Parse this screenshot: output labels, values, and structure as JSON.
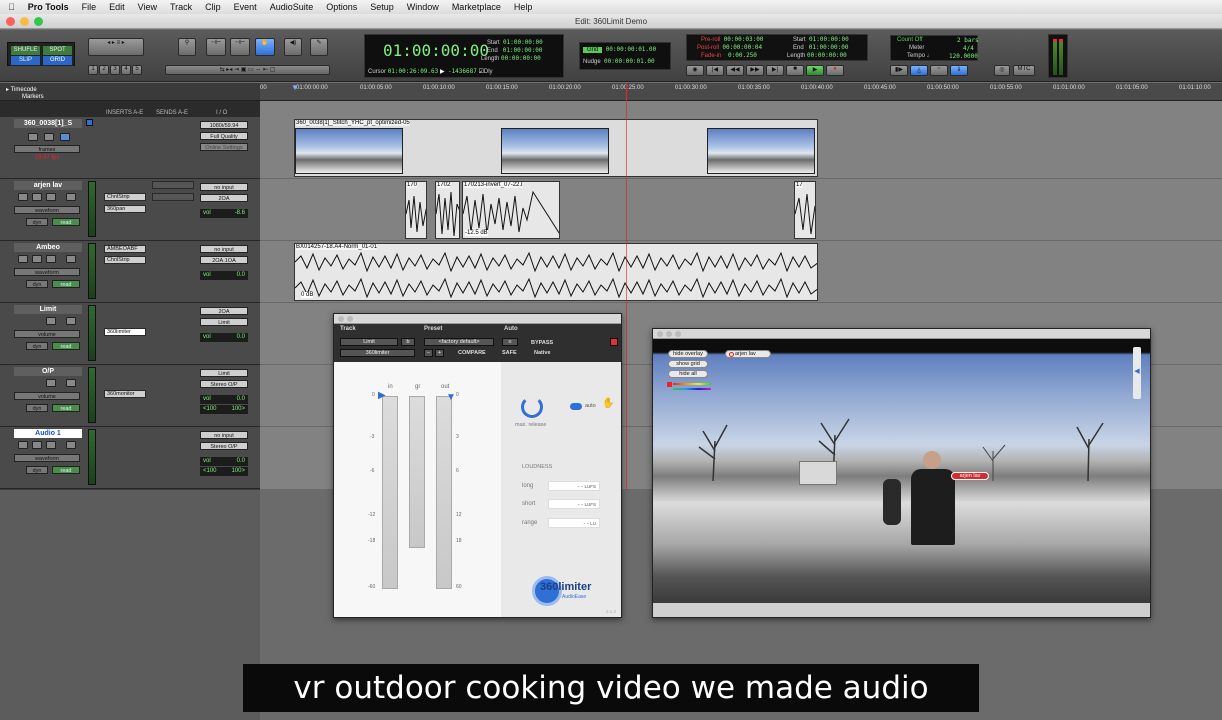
{
  "menubar": {
    "items": [
      "Pro Tools",
      "File",
      "Edit",
      "View",
      "Track",
      "Clip",
      "Event",
      "AudioSuite",
      "Options",
      "Setup",
      "Window",
      "Marketplace",
      "Help"
    ]
  },
  "window": {
    "title": "Edit: 360Limit Demo"
  },
  "toolbar": {
    "modes": [
      "SHUFLE",
      "SPOT",
      "SLIP",
      "GRID"
    ],
    "zoom_presets": [
      "1",
      "2",
      "3",
      "4",
      "5"
    ],
    "counter": {
      "main": "01:00:00:00",
      "start_label": "Start",
      "start": "01:00:00:00",
      "end_label": "End",
      "end": "01:00:00:00",
      "length_label": "Length",
      "length": "00:00:00:00",
      "cursor_label": "Cursor",
      "cursor": "01:00:26:09.63",
      "cursor_value": "-1436687",
      "dly_label": "Dly"
    },
    "grid": {
      "grid_label": "Grid",
      "grid_value": "00:00:00:01.00",
      "nudge_label": "Nudge",
      "nudge_value": "00:00:00:01.00"
    },
    "transport": {
      "preroll_label": "Pre-roll",
      "preroll": "00:00:03:00",
      "postroll_label": "Post-roll",
      "postroll": "00:00:00:04",
      "fadein_label": "Fade-in",
      "fadein": "0:00.250",
      "start_label": "Start",
      "start": "01:00:00:00",
      "end_label": "End",
      "end": "01:00:00:00",
      "length_label": "Length",
      "length": "00:00:00:00"
    },
    "meter": {
      "countoff_label": "Count Off",
      "countoff": "2 bars",
      "meter_label": "Meter",
      "meter": "4/4",
      "tempo_label": "Tempo",
      "tempo": "120.0000"
    },
    "misc": [
      "MTC"
    ]
  },
  "rulers": {
    "timecode_label": "Timecode",
    "markers_label": "Markers",
    "ticks": [
      "00",
      "01:00:00:00",
      "01:00:05:00",
      "01:00:10:00",
      "01:00:15:00",
      "01:00:20:00",
      "01:00:25:00",
      "01:00:30:00",
      "01:00:35:00",
      "01:00:40:00",
      "01:00:45:00",
      "01:00:50:00",
      "01:00:55:00",
      "01:01:00:00",
      "01:01:05:00",
      "01:01:10:00"
    ]
  },
  "columns": {
    "inserts": "INSERTS A-E",
    "sends": "SENDS A-E",
    "io": "I / O"
  },
  "tracks": [
    {
      "name": "360_0038[1]_S",
      "view": "frames",
      "fps": "29.97 fps",
      "io_in": "1080i/59.94",
      "io_out": "Full Quality",
      "io_extra": "Online Settings"
    },
    {
      "name": "arjen lav",
      "view": "waveform",
      "mode": "read",
      "dyn": "dyn",
      "inserts": [
        "ChnlStrip",
        "360pan"
      ],
      "io_in": "no input",
      "io_out": "2OA",
      "vol_label": "vol",
      "vol": "-8.6"
    },
    {
      "name": "Ambeo",
      "view": "waveform",
      "mode": "read",
      "dyn": "dyn",
      "inserts": [
        "AMBEOABF",
        "ChnlStrip"
      ],
      "io_in": "no input",
      "io_out": "2OA.1OA",
      "vol_label": "vol",
      "vol": "0.0"
    },
    {
      "name": "Limit",
      "view": "volume",
      "mode": "read",
      "dyn": "dyn",
      "inserts": [
        "360limiter"
      ],
      "io_in": "2OA",
      "io_out": "Limit",
      "vol_label": "vol",
      "vol": "0.0"
    },
    {
      "name": "O/P",
      "view": "volume",
      "mode": "read",
      "dyn": "dyn",
      "inserts": [
        "360monitor"
      ],
      "io_in": "Limit",
      "io_out": "Stereo O/P",
      "vol_label": "vol",
      "vol": "0.0",
      "pan_l": "<100",
      "pan_r": "100>"
    },
    {
      "name": "Audio 1",
      "view": "waveform",
      "mode": "read",
      "dyn": "dyn",
      "inserts": [],
      "io_in": "no input",
      "io_out": "Stereo O/P",
      "vol_label": "vol",
      "vol": "0.0",
      "pan_l": "<100",
      "pan_r": "100>"
    }
  ],
  "clips": {
    "video": "360_0038[1]_Stitch_YHC_pt_optimized-05",
    "lav": [
      "170",
      "1702",
      "170213-invert_07-22.l",
      "17"
    ],
    "lav_gain": "-12.5 dB",
    "ambeo": "BX014257-18.A4-Norm_01-01",
    "ambeo_gain": "0 dB"
  },
  "plugin": {
    "track_label": "Track",
    "preset_label": "Preset",
    "auto_label": "Auto",
    "track_name": "Limit",
    "track_sel": "b",
    "plugin_name": "360limiter",
    "preset": "<factory default>",
    "compare": "COMPARE",
    "bypass": "BYPASS",
    "safe": "SAFE",
    "native": "Native",
    "minus": "−",
    "plus": "+",
    "meter_labels": [
      "in",
      "gr",
      "out"
    ],
    "scale": [
      "0",
      "-3",
      "-6",
      "-12",
      "-18",
      "-60"
    ],
    "scale_r": [
      "0",
      "3",
      "6",
      "12",
      "18",
      "60"
    ],
    "knob_label": "max. release",
    "auto_toggle": "auto",
    "loudness_title": "LOUDNESS",
    "loudness": [
      {
        "label": "long",
        "value": "- -",
        "unit": "LUFS"
      },
      {
        "label": "short",
        "value": "- -",
        "unit": "LUFS"
      },
      {
        "label": "range",
        "value": "- -",
        "unit": "LU"
      }
    ],
    "logo_main": "360limiter",
    "logo_sub": "AudioEase",
    "version": "2.1.2"
  },
  "video": {
    "buttons": [
      "hide overlay",
      "show grid",
      "hide all"
    ],
    "track_tag": "arjen lav",
    "person_tag": "arjen lav"
  },
  "subtitle": "vr outdoor cooking video we made audio"
}
